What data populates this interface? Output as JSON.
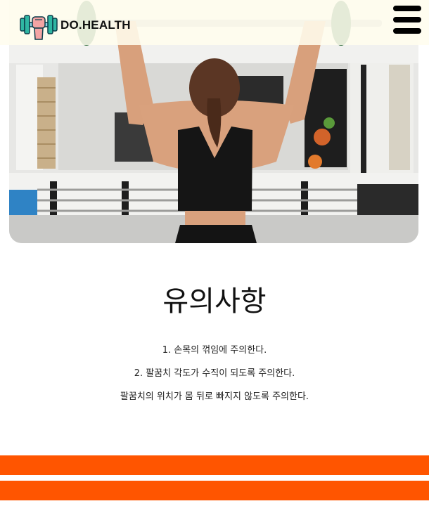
{
  "header": {
    "brand": "DO.HEALTH",
    "logo_icon": "dumbbell-fist-icon",
    "menu_icon": "hamburger-menu-icon"
  },
  "hero": {
    "image": "woman-lifting-barbell-in-gym"
  },
  "main": {
    "title": "유의사항",
    "tips": [
      "1. 손목의 꺾임에 주의한다.",
      "2. 팔꿈치 각도가 수직이 되도록 주의한다.",
      "팔꿈치의 위치가 몸 뒤로 빠지지 않도록 주의한다."
    ]
  },
  "colors": {
    "accent": "#ff5500",
    "header_bg": "#fffdee"
  }
}
